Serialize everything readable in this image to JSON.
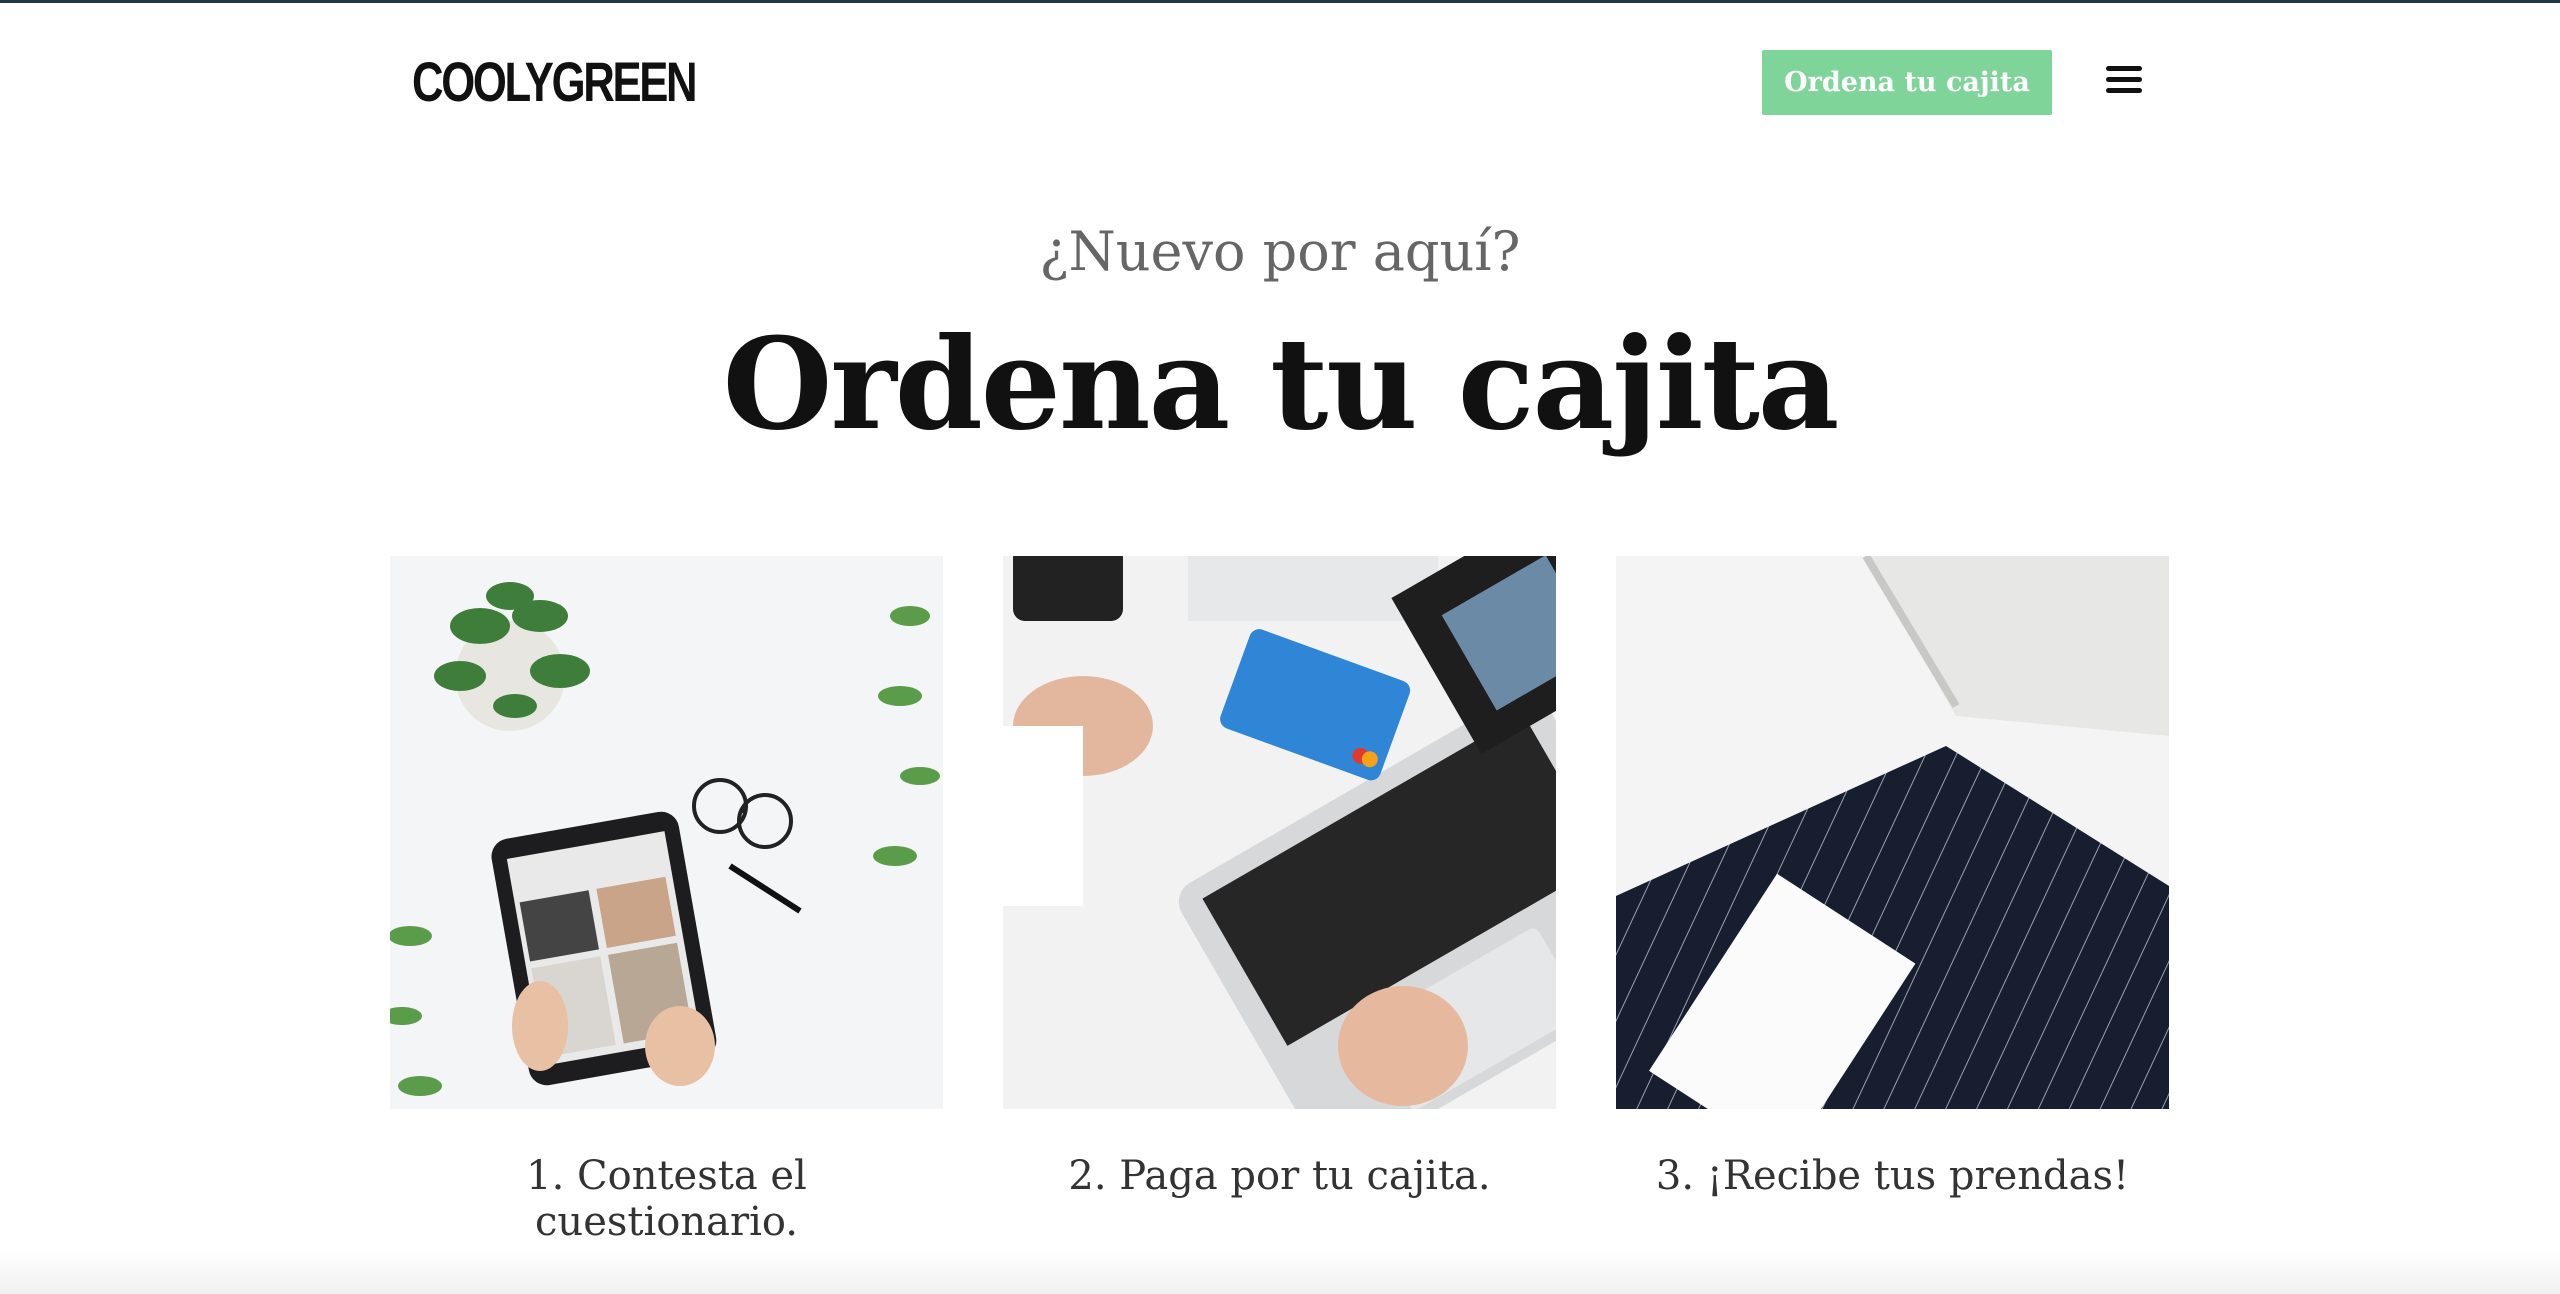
{
  "header": {
    "logo": "COOLYGREEN",
    "cta_label": "Ordena tu cajita",
    "menu_icon": "hamburger-menu-icon",
    "cta_color": "#7fd49a"
  },
  "hero": {
    "eyebrow": "¿Nuevo por aquí?",
    "title": "Ordena tu cajita"
  },
  "steps": [
    {
      "caption": "1. Contesta el cuestionario.",
      "image": "tablet-with-plants"
    },
    {
      "caption": "2. Paga por tu cajita.",
      "image": "laptop-credit-card"
    },
    {
      "caption": "3. ¡Recibe tus prendas!",
      "image": "box-with-striped-clothes"
    }
  ]
}
